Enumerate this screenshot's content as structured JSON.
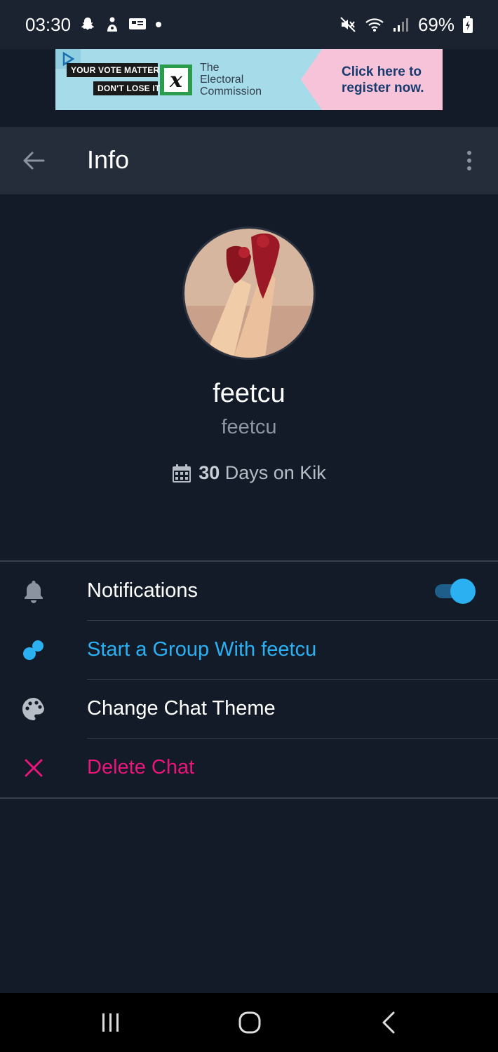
{
  "status_bar": {
    "time": "03:30",
    "battery": "69%",
    "left_icons": [
      "snapchat-icon",
      "app-notification-icon",
      "message-icon",
      "more-notifications-dot"
    ],
    "right_icons": [
      "mute-icon",
      "wifi-icon",
      "signal-icon",
      "battery-charging-icon"
    ]
  },
  "ad": {
    "tag_line_1": "YOUR VOTE MATTERS",
    "tag_line_2": "DON'T LOSE IT",
    "org_line_1": "The",
    "org_line_2": "Electoral",
    "org_line_3": "Commission",
    "cta_line_1": "Click here to",
    "cta_line_2": "register now.",
    "colors": {
      "background": "#a6dcea",
      "cta_background": "#f7c3d8",
      "cta_text": "#173a6e"
    }
  },
  "app_bar": {
    "title": "Info",
    "back_icon": "arrow-left-icon",
    "menu_icon": "more-vert-icon"
  },
  "profile": {
    "display_name": "feetcu",
    "username": "feetcu",
    "days_count": "30",
    "days_suffix": "Days on Kik",
    "calendar_icon": "calendar-icon"
  },
  "menu": {
    "notifications": {
      "label": "Notifications",
      "icon": "bell-icon",
      "toggle_on": true
    },
    "start_group": {
      "label": "Start a Group With feetcu",
      "icon": "group-dots-icon",
      "color": "#2bb0f2"
    },
    "change_theme": {
      "label": "Change Chat Theme",
      "icon": "palette-icon"
    },
    "delete_chat": {
      "label": "Delete Chat",
      "icon": "close-icon",
      "color": "#e8157a"
    }
  },
  "nav_bar": {
    "items": [
      "recents-icon",
      "home-icon",
      "back-icon"
    ]
  },
  "colors": {
    "background": "#131b28",
    "app_bar": "#252d3a",
    "accent_blue": "#2bb0f2",
    "accent_pink": "#e8157a",
    "muted_text": "#8d96a2"
  }
}
